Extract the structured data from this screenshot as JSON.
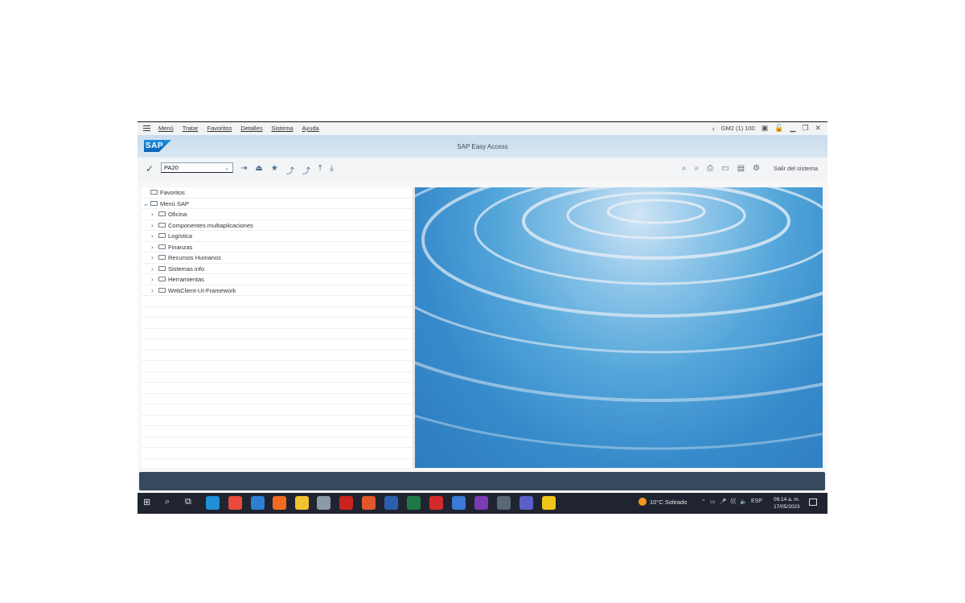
{
  "menubar": {
    "items": [
      "Menú",
      "Tratar",
      "Favoritos",
      "Detalles",
      "Sistema",
      "Ayuda"
    ],
    "system_info": "GM2 (1) 100"
  },
  "titlebar": {
    "logo_text": "SAP",
    "title": "SAP Easy Access"
  },
  "toolbar": {
    "command_value": "PA20",
    "logout_label": "Salir del sistema"
  },
  "tree": {
    "favorites": "Favoritos",
    "root": "Menú SAP",
    "items": [
      "Oficina",
      "Componentes multiaplicaciones",
      "Logística",
      "Finanzas",
      "Recursos Humanos",
      "Sistemas info",
      "Herramientas",
      "WebClient-UI-Framework"
    ]
  },
  "taskbar": {
    "weather": "10°C  Soleado",
    "language": "ESP",
    "time": "09:14 a. m.",
    "date": "17/05/2023"
  },
  "colors": {
    "sap_blue": "#0a6ed1",
    "titlebar": "#d2e2f0",
    "status_bar": "#354a5f",
    "taskbar": "#1f2430"
  }
}
